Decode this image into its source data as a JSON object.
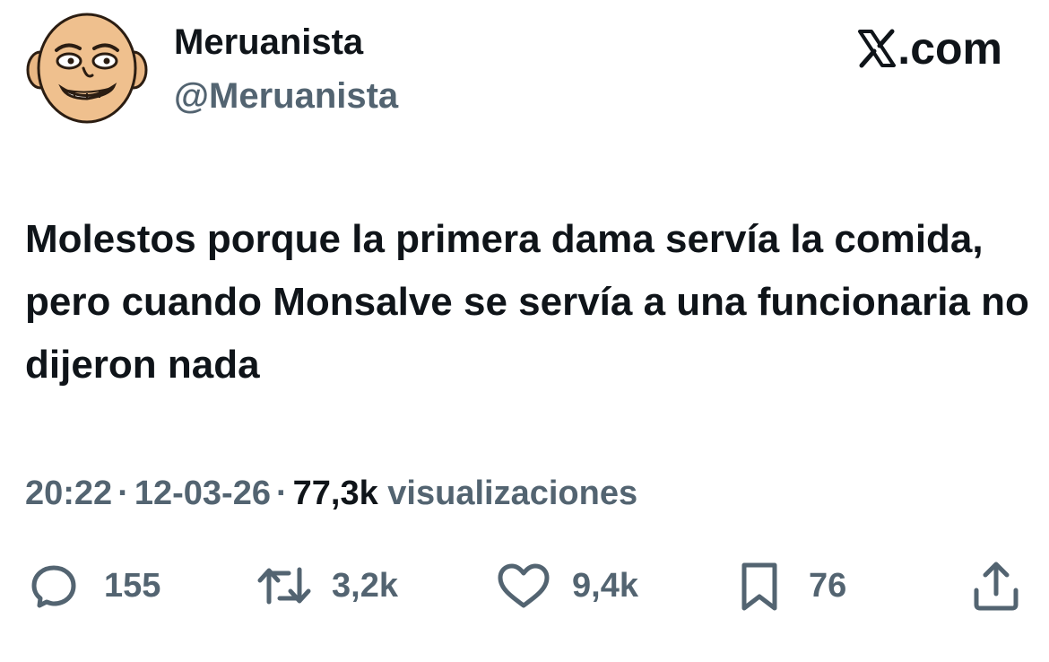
{
  "author": {
    "display_name": "Meruanista",
    "handle": "@Meruanista",
    "avatar_icon": "cartoon-bald-face-avatar"
  },
  "brand": {
    "icon": "x-logo-icon",
    "domain": ".com"
  },
  "tweet": {
    "text": "Molestos porque la primera dama servía la comida, pero cuando Monsalve se servía a una funcionaria no dijeron nada"
  },
  "meta": {
    "time": "20:22",
    "date": "12-03-26",
    "views_count": "77,3k",
    "views_label": "visualizaciones",
    "separator": "·"
  },
  "actions": {
    "replies": {
      "icon": "reply-bubble-icon",
      "count": "155"
    },
    "reposts": {
      "icon": "repost-icon",
      "count": "3,2k"
    },
    "likes": {
      "icon": "heart-icon",
      "count": "9,4k"
    },
    "bookmarks": {
      "icon": "bookmark-icon",
      "count": "76"
    },
    "share": {
      "icon": "share-icon"
    }
  },
  "colors": {
    "primary_text": "#0f1419",
    "secondary_text": "#536471",
    "background": "#ffffff"
  }
}
